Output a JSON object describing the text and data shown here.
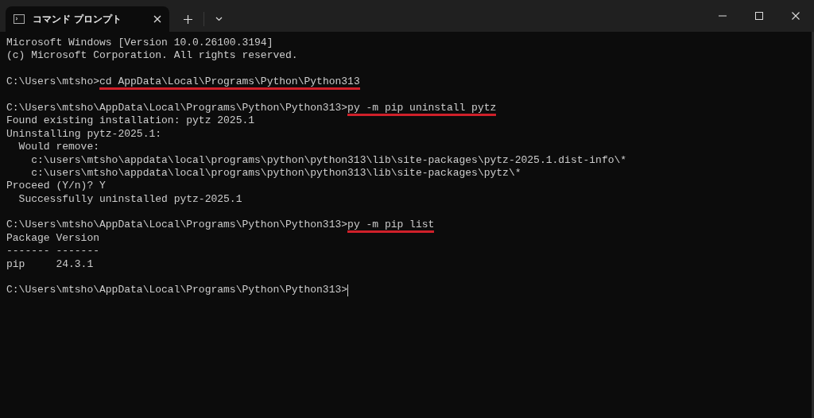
{
  "window": {
    "tab_title": "コマンド プロンプト"
  },
  "terminal": {
    "lines": [
      {
        "kind": "output",
        "text": "Microsoft Windows [Version 10.0.26100.3194]"
      },
      {
        "kind": "output",
        "text": "(c) Microsoft Corporation. All rights reserved."
      },
      {
        "kind": "blank"
      },
      {
        "kind": "prompt",
        "prompt": "C:\\Users\\mtsho>",
        "command": "cd AppData\\Local\\Programs\\Python\\Python313",
        "underlined": true
      },
      {
        "kind": "blank"
      },
      {
        "kind": "prompt",
        "prompt": "C:\\Users\\mtsho\\AppData\\Local\\Programs\\Python\\Python313>",
        "command": "py -m pip uninstall pytz",
        "underlined": true
      },
      {
        "kind": "output",
        "text": "Found existing installation: pytz 2025.1"
      },
      {
        "kind": "output",
        "text": "Uninstalling pytz-2025.1:"
      },
      {
        "kind": "output",
        "text": "  Would remove:"
      },
      {
        "kind": "output",
        "text": "    c:\\users\\mtsho\\appdata\\local\\programs\\python\\python313\\lib\\site-packages\\pytz-2025.1.dist-info\\*"
      },
      {
        "kind": "output",
        "text": "    c:\\users\\mtsho\\appdata\\local\\programs\\python\\python313\\lib\\site-packages\\pytz\\*"
      },
      {
        "kind": "output",
        "text": "Proceed (Y/n)? Y"
      },
      {
        "kind": "output",
        "text": "  Successfully uninstalled pytz-2025.1"
      },
      {
        "kind": "blank"
      },
      {
        "kind": "prompt",
        "prompt": "C:\\Users\\mtsho\\AppData\\Local\\Programs\\Python\\Python313>",
        "command": "py -m pip list",
        "underlined": true
      },
      {
        "kind": "output",
        "text": "Package Version"
      },
      {
        "kind": "output",
        "text": "------- -------"
      },
      {
        "kind": "output",
        "text": "pip     24.3.1"
      },
      {
        "kind": "blank"
      },
      {
        "kind": "prompt",
        "prompt": "C:\\Users\\mtsho\\AppData\\Local\\Programs\\Python\\Python313>",
        "cursor": true
      }
    ]
  }
}
